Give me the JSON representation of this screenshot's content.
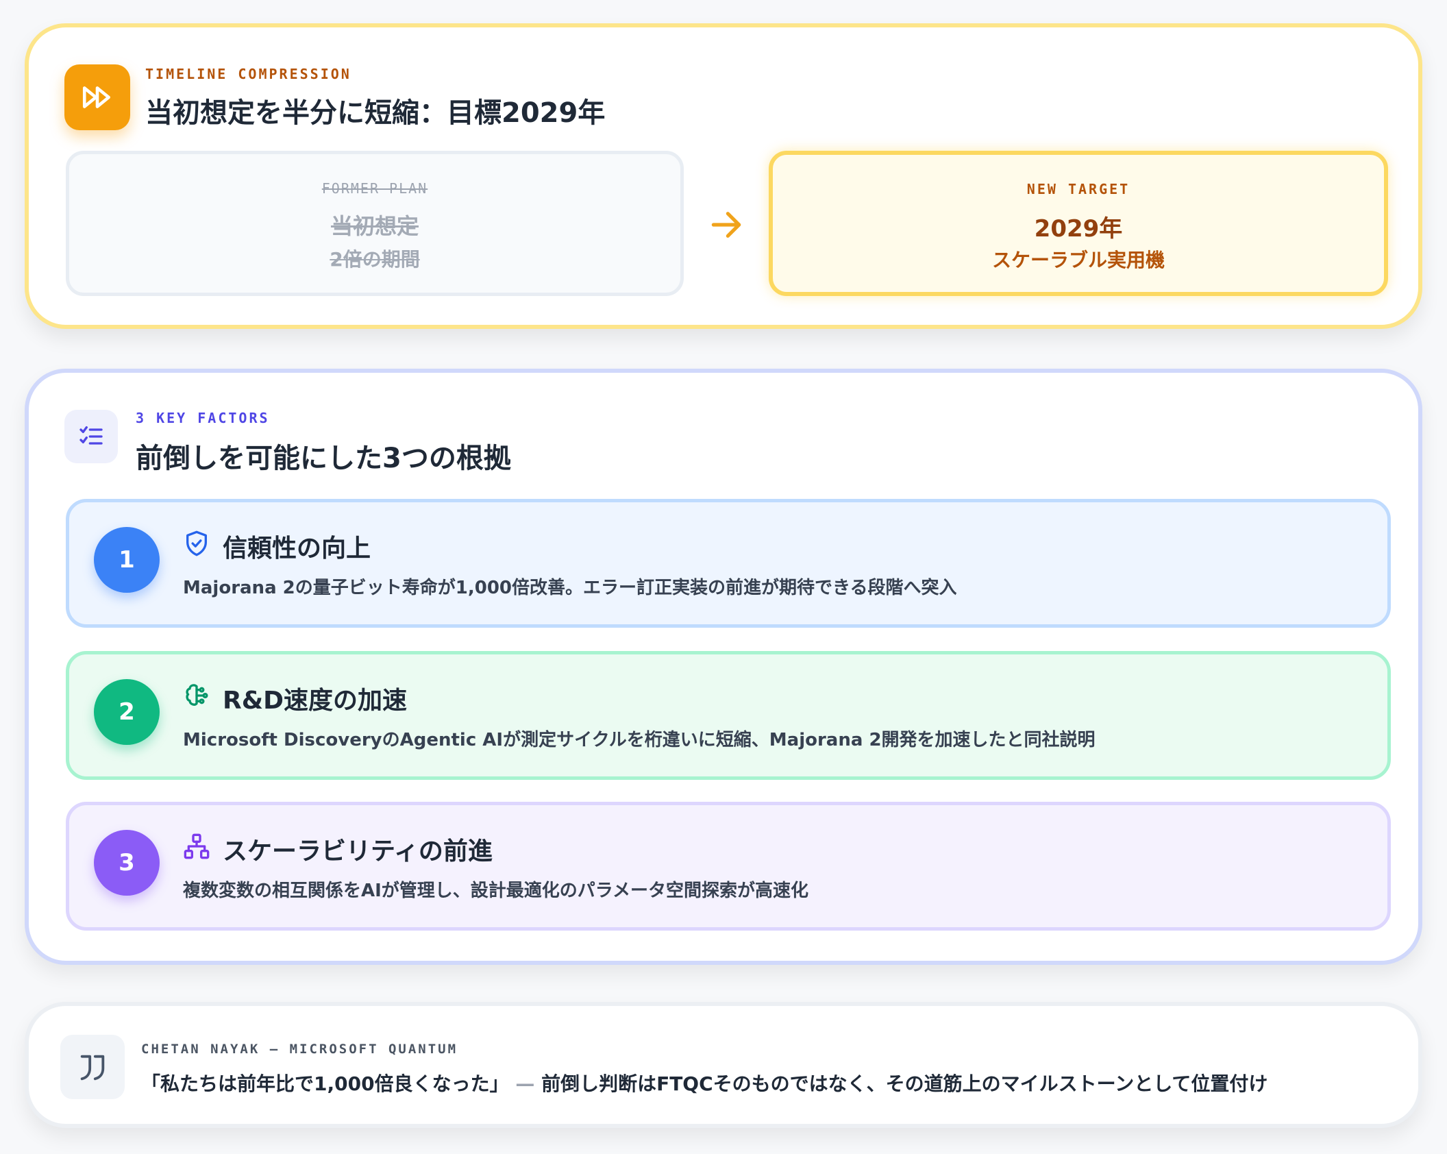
{
  "timeline": {
    "eyebrow": "TIMELINE COMPRESSION",
    "title": "当初想定を半分に短縮：目標2029年",
    "former": {
      "label": "FORMER PLAN",
      "value": "当初想定",
      "sub": "2倍の期間"
    },
    "target": {
      "label": "NEW TARGET",
      "value": "2029年",
      "sub": "スケーラブル実用機"
    },
    "icon": "fast-forward-icon"
  },
  "factors": {
    "eyebrow": "3 KEY FACTORS",
    "title": "前倒しを可能にした3つの根拠",
    "icon": "checklist-icon",
    "items": [
      {
        "number": "1",
        "icon": "shield-check-icon",
        "title": "信頼性の向上",
        "desc": "Majorana 2の量子ビット寿命が1,000倍改善。エラー訂正実装の前進が期待できる段階へ突入",
        "color": "#3b82f6"
      },
      {
        "number": "2",
        "icon": "brain-circuit-icon",
        "title": "R&D速度の加速",
        "desc": "Microsoft DiscoveryのAgentic AIが測定サイクルを桁違いに短縮、Majorana 2開発を加速したと同社説明",
        "color": "#10b981"
      },
      {
        "number": "3",
        "icon": "network-icon",
        "title": "スケーラビリティの前進",
        "desc": "複数変数の相互関係をAIが管理し、設計最適化のパラメータ空間探索が高速化",
        "color": "#8b5cf6"
      }
    ]
  },
  "quote": {
    "icon": "quote-icon",
    "attribution": "CHETAN NAYAK — MICROSOFT QUANTUM",
    "text": "「私たちは前年比で1,000倍良くなった」",
    "dash": " — ",
    "comment": "前倒し判断はFTQCそのものではなく、その道筋上のマイルストーンとして位置付け"
  },
  "colors": {
    "amber": "#f59e0b",
    "indigo": "#4f46e5",
    "blue": "#3b82f6",
    "green": "#10b981",
    "purple": "#8b5cf6"
  }
}
